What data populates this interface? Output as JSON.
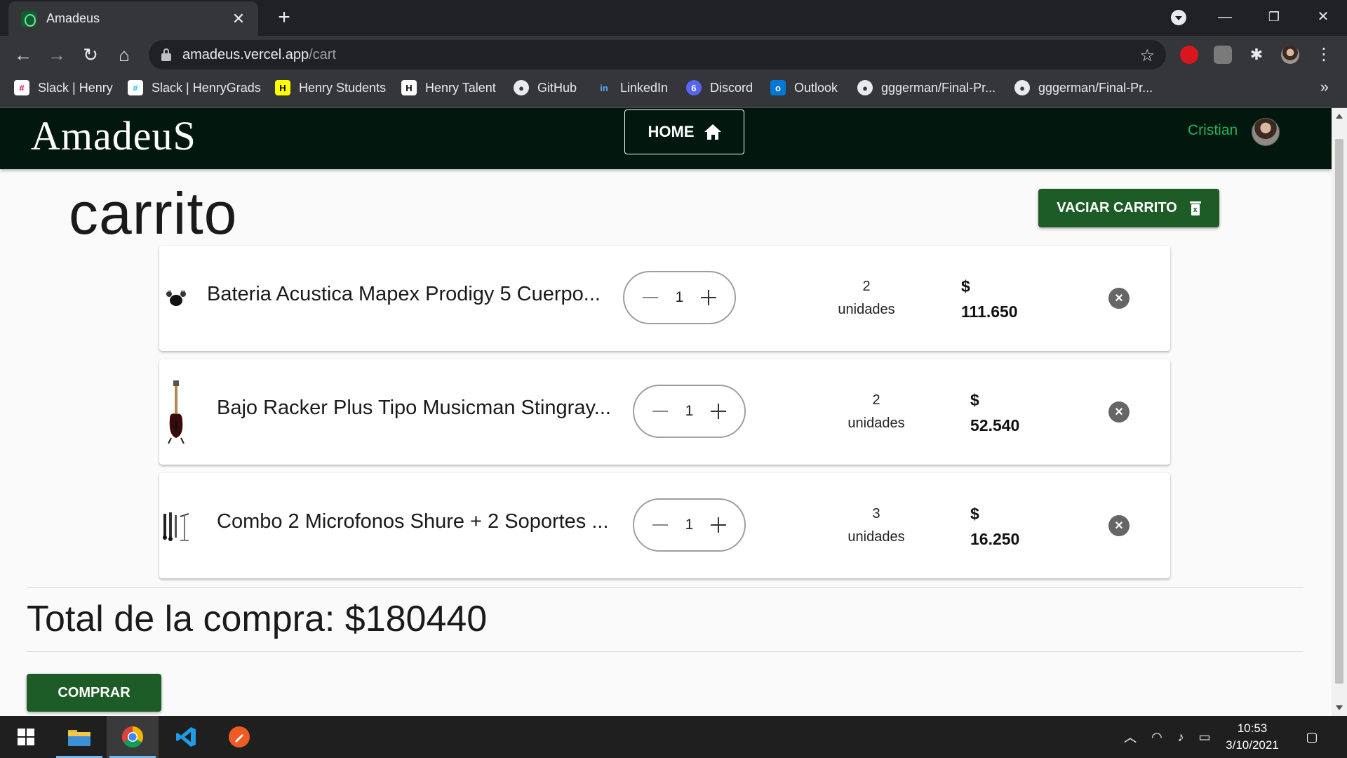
{
  "browser": {
    "tab_title": "Amadeus",
    "tab_close": "✕",
    "new_tab": "+",
    "url_host": "amadeus.vercel.app",
    "url_path": "/cart",
    "window_controls": [
      "—",
      "❐",
      "✕"
    ],
    "bookmarks": [
      {
        "label": "Slack | Henry",
        "icon": "slack-icon",
        "color": "#e01e5a"
      },
      {
        "label": "Slack | HenryGrads",
        "icon": "slack-icon",
        "color": "#36c5f0"
      },
      {
        "label": "Henry Students",
        "icon": "henry-icon",
        "color": "#ffff01"
      },
      {
        "label": "Henry Talent",
        "icon": "henry-talent-icon",
        "color": "#000000"
      },
      {
        "label": "GitHub",
        "icon": "github-icon",
        "color": "#e8eaed"
      },
      {
        "label": "LinkedIn",
        "icon": "linkedin-icon",
        "color": "#0a66c2"
      },
      {
        "label": "Discord",
        "icon": "discord-icon",
        "color": "#5865f2"
      },
      {
        "label": "Outlook",
        "icon": "outlook-icon",
        "color": "#0078d4"
      },
      {
        "label": "gggerman/Final-Pr...",
        "icon": "github-icon",
        "color": "#e8eaed"
      },
      {
        "label": "gggerman/Final-Pr...",
        "icon": "github-icon",
        "color": "#e8eaed"
      }
    ],
    "bookmarks_more": "»"
  },
  "app": {
    "logo": "AmadeuS",
    "home_label": "HOME",
    "username": "Cristian",
    "accent_color": "#1d5c27",
    "header_color": "#02180f"
  },
  "cart": {
    "title": "carrito",
    "empty_label": "VACIAR CARRITO",
    "items": [
      {
        "name": "Bateria Acustica Mapex Prodigy 5 Cuerpo...",
        "qty": "1",
        "units_count": "2",
        "units_label": "unidades",
        "currency": "$",
        "price": "111.650",
        "thumb": "drum-kit"
      },
      {
        "name": "Bajo Racker Plus Tipo Musicman Stingray...",
        "qty": "1",
        "units_count": "2",
        "units_label": "unidades",
        "currency": "$",
        "price": "52.540",
        "thumb": "bass-guitar"
      },
      {
        "name": "Combo 2 Microfonos Shure + 2 Soportes ...",
        "qty": "1",
        "units_count": "3",
        "units_label": "unidades",
        "currency": "$",
        "price": "16.250",
        "thumb": "microphones"
      }
    ],
    "total_label": "Total de la compra: $180440",
    "buy_label": "COMPRAR"
  },
  "taskbar": {
    "time": "10:53",
    "date": "3/10/2021"
  }
}
